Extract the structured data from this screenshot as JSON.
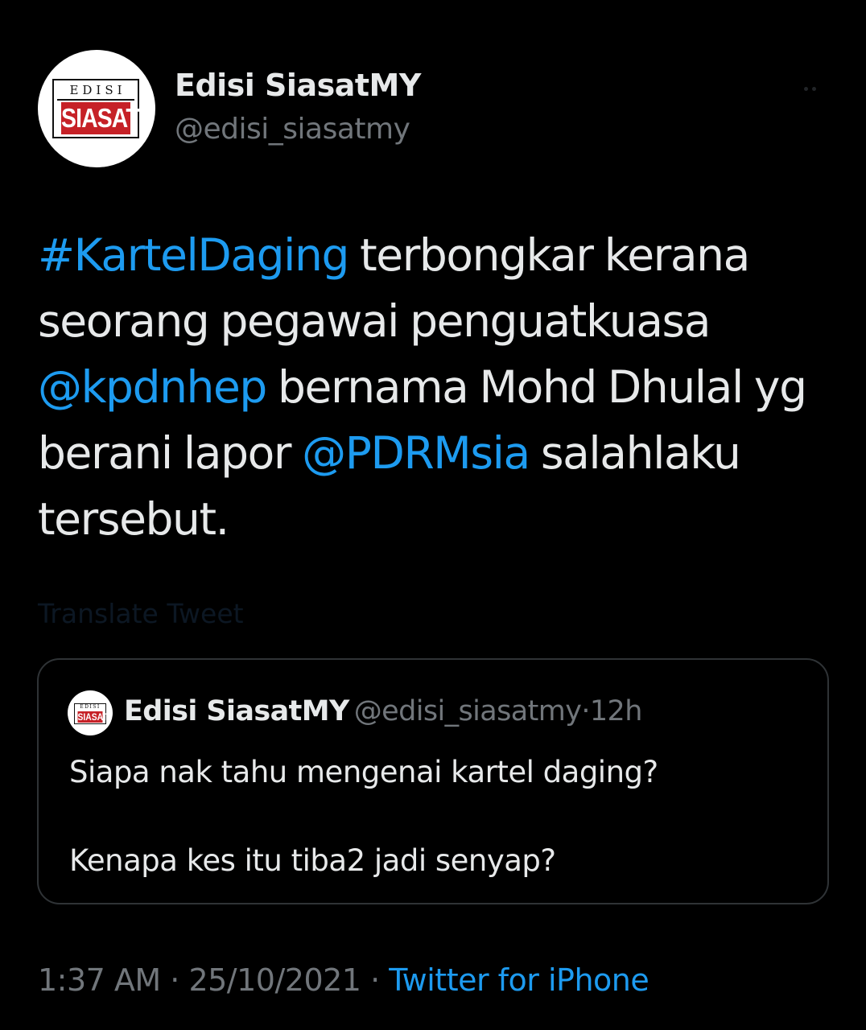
{
  "author": {
    "display_name": "Edisi SiasatMY",
    "handle": "@edisi_siasatmy",
    "avatar_logo": {
      "top_text": "EDISI",
      "bottom_text": "SIASAT",
      "accent_color": "#c62127"
    }
  },
  "more_button": {
    "icon": "more-horizontal-icon"
  },
  "tweet": {
    "lines": [
      [
        {
          "text": "#KartelDaging",
          "type": "hashtag"
        },
        {
          "text": " terbongkar kerana",
          "type": "text"
        }
      ],
      [
        {
          "text": "seorang pegawai penguatkuasa",
          "type": "text"
        }
      ],
      [
        {
          "text": "@kpdnhep",
          "type": "mention"
        },
        {
          "text": " bernama Mohd Dhulal yg",
          "type": "text"
        }
      ],
      [
        {
          "text": "berani lapor ",
          "type": "text"
        },
        {
          "text": "@PDRMsia",
          "type": "mention"
        },
        {
          "text": " salahlaku",
          "type": "text"
        }
      ],
      [
        {
          "text": "tersebut.",
          "type": "text"
        }
      ]
    ],
    "translate_label": "Translate Tweet"
  },
  "quoted_tweet": {
    "display_name": "Edisi SiasatMY",
    "handle": "@edisi_siasatmy",
    "separator": "·",
    "time": "12h",
    "line1": "Siapa nak tahu mengenai kartel daging?",
    "line2": "Kenapa kes itu tiba2 jadi senyap?",
    "avatar_logo": {
      "top_text": "EDISI",
      "bottom_text": "SIASAT"
    }
  },
  "meta": {
    "time": "1:37 AM",
    "sep1": " · ",
    "date": "25/10/2021",
    "sep2": " · ",
    "source": "Twitter for iPhone"
  },
  "colors": {
    "background": "#000000",
    "text": "#e7e9ea",
    "muted": "#71767b",
    "link": "#1d9bf0",
    "border": "#2f3336"
  }
}
